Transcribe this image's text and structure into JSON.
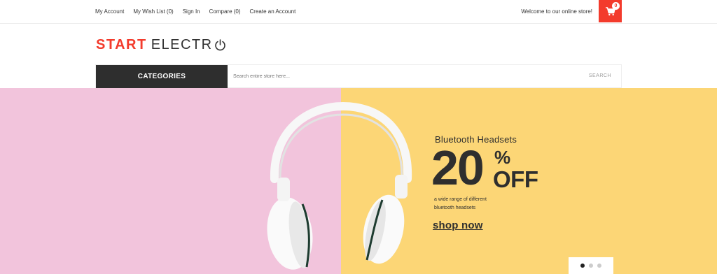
{
  "header": {
    "links": [
      "My Account",
      "My Wish List (0)",
      "Sign In",
      "Compare (0)",
      "Create an Account"
    ],
    "welcome": "Welcome to our online store!",
    "cart_count": "0",
    "cart_icon": "cart-icon"
  },
  "logo": {
    "part1": "START",
    "part2": "ELECTR",
    "power_icon": "power-icon"
  },
  "search": {
    "categories_label": "CATEGORIES",
    "placeholder": "Search entire store here...",
    "button_label": "SEARCH"
  },
  "banner": {
    "subtitle": "Bluetooth Headsets",
    "discount": "20",
    "percent": "%",
    "off": "OFF",
    "desc_line1": "a wide range of different",
    "desc_line2": "bluetooth headsets",
    "cta": "shop now",
    "slide_count": 3,
    "active_slide": 1
  },
  "colors": {
    "accent": "#f33b2c",
    "pink": "#f2c4dc",
    "yellow": "#fcd676",
    "dark": "#2e2e2e"
  }
}
